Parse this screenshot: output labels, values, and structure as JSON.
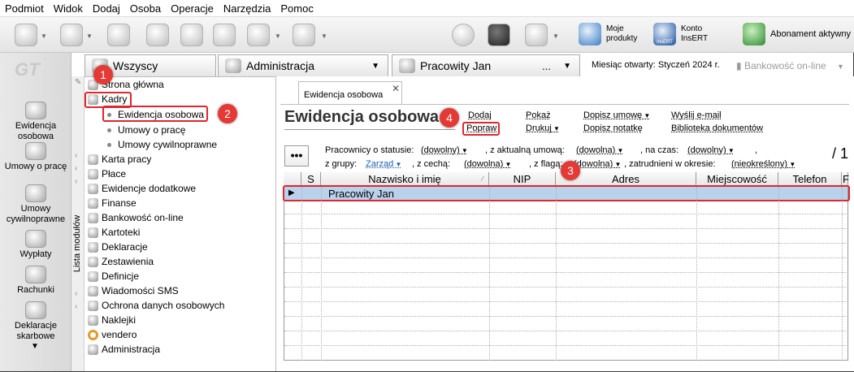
{
  "menu": [
    "Podmiot",
    "Widok",
    "Dodaj",
    "Osoba",
    "Operacje",
    "Narzędzia",
    "Pomoc"
  ],
  "toolbar": {
    "moje_produkty": "Moje\nprodukty",
    "konto": "Konto\nInsERT",
    "insert_label": "InsERT",
    "abonament": "Abonament aktywny"
  },
  "logo_text": "GT",
  "iconbar": [
    "Ewidencja osobowa",
    "Umowy o pracę",
    "Umowy cywilnoprawne",
    "Wypłaty",
    "Rachunki",
    "Deklaracje skarbowe"
  ],
  "tabs": {
    "wszyscy": "Wszyscy",
    "administracja": "Administracja",
    "pracowity": "Pracowity Jan",
    "ellipsis": "..."
  },
  "month_label": "Miesiąc otwarty: Styczeń 2024 r.",
  "bank_label": "Bankowość on-line",
  "modules_label": "Lista modułów",
  "tree": [
    "Strona główna",
    "Kadry",
    "Ewidencja osobowa",
    "Umowy o pracę",
    "Umowy cywilnoprawne",
    "Karta pracy",
    "Płace",
    "Ewidencje dodatkowe",
    "Finanse",
    "Bankowość on-line",
    "Kartoteki",
    "Deklaracje",
    "Zestawienia",
    "Definicje",
    "Wiadomości SMS",
    "Ochrona danych osobowych",
    "Naklejki",
    "vendero",
    "Administracja"
  ],
  "content_tab": "Ewidencja osobowa",
  "title": "Ewidencja osobowa",
  "actions": {
    "dodaj": "Dodaj",
    "popraw": "Popraw",
    "pokaz": "Pokaż",
    "drukuj": "Drukuj",
    "dopisz_umowe": "Dopisz umowę",
    "dopisz_notatke": "Dopisz notatkę",
    "wyslij": "Wyślij e-mail",
    "biblioteka": "Biblioteka dokumentów"
  },
  "filters": {
    "status_label": "Pracownicy o statusie:",
    "status_val": "(dowolny)",
    "umowa_label": ", z aktualną umową:",
    "umowa_val": "(dowolna)",
    "czas_label": ", na czas:",
    "czas_val": "(dowolny)",
    "comma": ",",
    "grupa_label": "z grupy:",
    "grupa_val": "Zarząd",
    "cecha_label": ", z cechą:",
    "cecha_val": "(dowolna)",
    "flaga_label": ", z flagą:",
    "flaga_val": "(dowolna)",
    "okres_label": ", zatrudnieni w okresie:",
    "okres_val": "(nieokreślony)"
  },
  "dots": "•••",
  "count": "/ 1",
  "columns": [
    "S",
    "Nazwisko i imię",
    "NIP",
    "Adres",
    "Miejscowość",
    "Telefon",
    "F"
  ],
  "rows": [
    {
      "name": "Pracowity Jan"
    }
  ],
  "badges": [
    "1",
    "2",
    "3",
    "4"
  ]
}
